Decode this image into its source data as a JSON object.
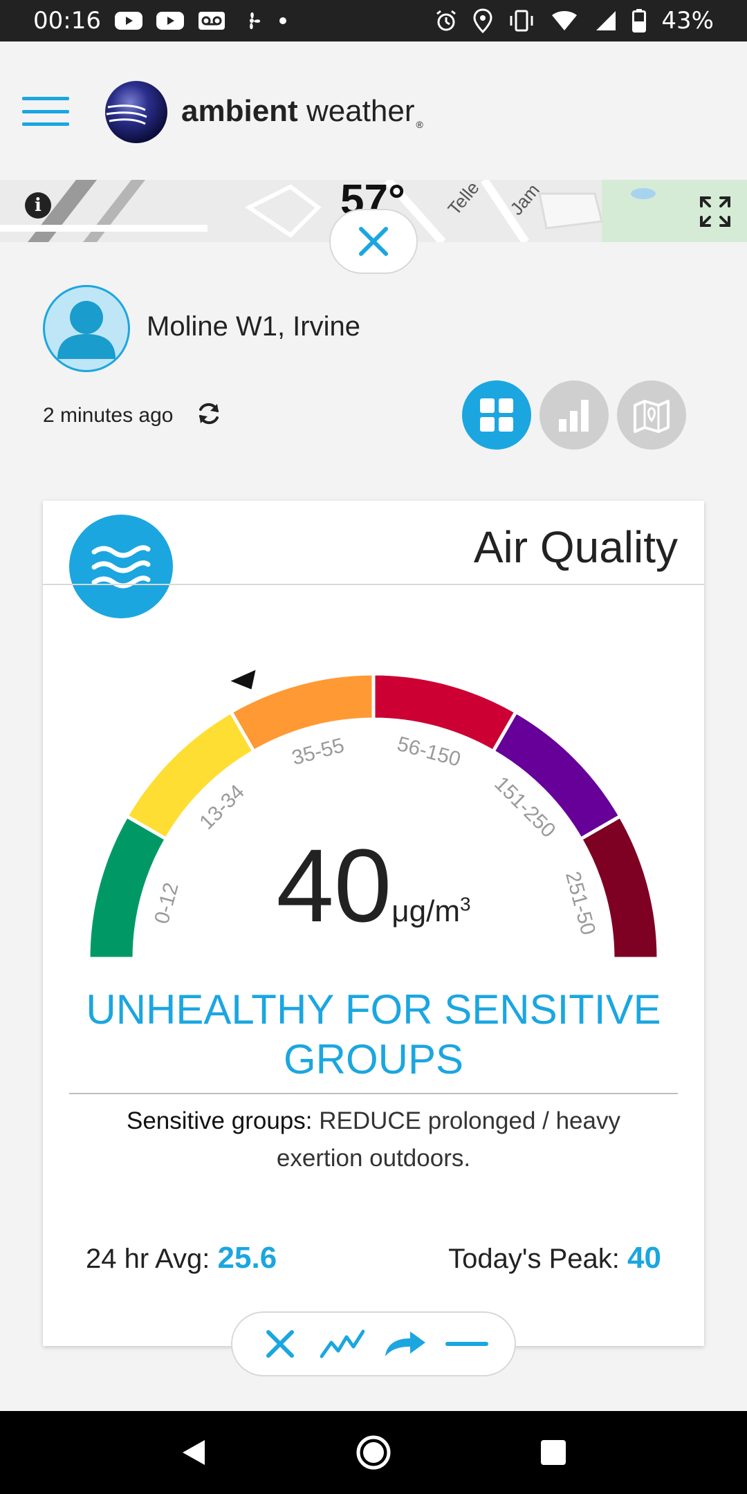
{
  "status_bar": {
    "time": "00:16",
    "battery": "43%"
  },
  "header": {
    "logo_bold": "ambient",
    "logo_light": "weather",
    "logo_reg": "®"
  },
  "map": {
    "temperature": "57°",
    "info_label": "i"
  },
  "station": {
    "name": "Moline W1, Irvine",
    "updated": "2 minutes ago"
  },
  "card": {
    "title": "Air Quality",
    "value": "40",
    "unit": "μg/m",
    "unit_sup": "3",
    "status": "UNHEALTHY FOR SENSITIVE GROUPS",
    "advice_label": "Sensitive groups:",
    "advice_text": "REDUCE prolonged / heavy exertion outdoors.",
    "avg_label": "24 hr Avg:",
    "avg_value": "25.6",
    "peak_label": "Today's Peak:",
    "peak_value": "40",
    "gauge_segments": [
      {
        "label": "0-12",
        "color": "#009966"
      },
      {
        "label": "13-34",
        "color": "#ffde33"
      },
      {
        "label": "35-55",
        "color": "#ff9933"
      },
      {
        "label": "56-150",
        "color": "#cc0033"
      },
      {
        "label": "151-250",
        "color": "#660099"
      },
      {
        "label": "251-50",
        "color": "#7e0023"
      }
    ],
    "active_segment": 2
  },
  "colors": {
    "accent": "#1ba6e0"
  },
  "icons": {
    "menu": "hamburger-icon",
    "close": "close-icon",
    "refresh": "refresh-icon",
    "grid": "grid-icon",
    "bars": "bar-chart-icon",
    "map": "map-icon",
    "wind": "air-waves-icon",
    "expand": "expand-icon",
    "toolbar": [
      "close-icon",
      "line-chart-icon",
      "share-icon",
      "minimize-icon"
    ]
  }
}
